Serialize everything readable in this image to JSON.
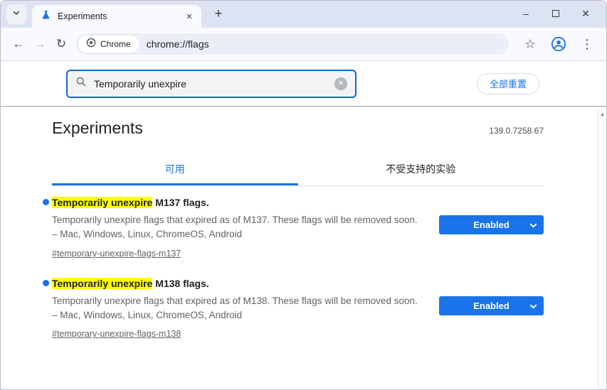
{
  "window": {
    "minimize_glyph": "–",
    "close_glyph": "✕"
  },
  "browser_tab": {
    "title": "Experiments",
    "close_glyph": "✕",
    "new_tab_glyph": "+"
  },
  "toolbar": {
    "back_glyph": "←",
    "forward_glyph": "→",
    "reload_glyph": "↻",
    "chip_label": "Chrome",
    "url": "chrome://flags",
    "star_glyph": "☆",
    "kebab_glyph": "⋮"
  },
  "search_bar": {
    "value": "Temporarily unexpire",
    "clear_glyph": "✕",
    "reset_all_label": "全部重置"
  },
  "page": {
    "title": "Experiments",
    "version": "139.0.7258.67",
    "tabs": [
      {
        "label": "可用"
      },
      {
        "label": "不受支持的实验"
      }
    ],
    "flags": [
      {
        "highlight": "Temporarily unexpire",
        "title_rest": " M137 flags.",
        "description": "Temporarily unexpire flags that expired as of M137. These flags will be removed soon. – Mac, Windows, Linux, ChromeOS, Android",
        "link": "#temporary-unexpire-flags-m137",
        "select_value": "Enabled"
      },
      {
        "highlight": "Temporarily unexpire",
        "title_rest": " M138 flags.",
        "description": "Temporarily unexpire flags that expired as of M138. These flags will be removed soon. – Mac, Windows, Linux, ChromeOS, Android",
        "link": "#temporary-unexpire-flags-m138",
        "select_value": "Enabled"
      }
    ]
  },
  "scrollbar": {
    "up_glyph": "▲"
  },
  "colors": {
    "accent": "#1a73e8",
    "highlight": "#ffff00",
    "select_bg": "#1a73e8"
  }
}
